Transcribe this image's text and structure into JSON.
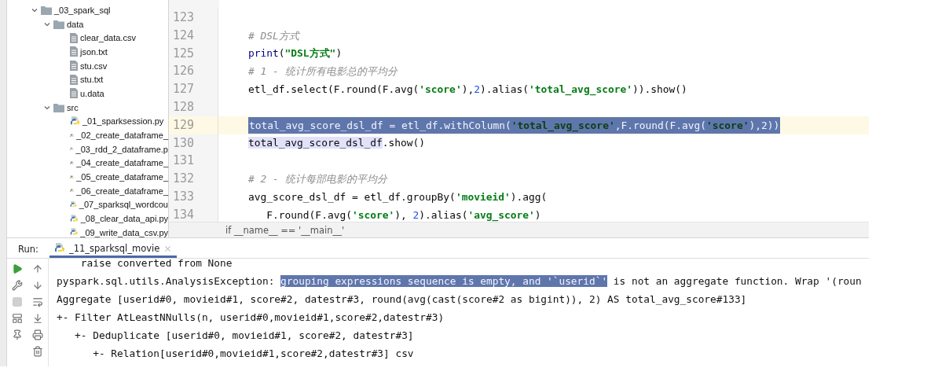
{
  "project_tree": [
    {
      "label": "_03_spark_sql",
      "kind": "folder",
      "expanded": true,
      "children": [
        {
          "label": "data",
          "kind": "folder",
          "expanded": true,
          "children": [
            {
              "label": "clear_data.csv",
              "kind": "file"
            },
            {
              "label": "json.txt",
              "kind": "file"
            },
            {
              "label": "stu.csv",
              "kind": "file"
            },
            {
              "label": "stu.txt",
              "kind": "file"
            },
            {
              "label": "u.data",
              "kind": "file"
            }
          ]
        },
        {
          "label": "src",
          "kind": "folder",
          "expanded": true,
          "children": [
            {
              "label": "_01_sparksession.py",
              "kind": "python"
            },
            {
              "label": "_02_create_dataframe_",
              "kind": "python"
            },
            {
              "label": "_03_rdd_2_dataframe.p",
              "kind": "python"
            },
            {
              "label": "_04_create_dataframe_",
              "kind": "python"
            },
            {
              "label": "_05_create_dataframe_",
              "kind": "python"
            },
            {
              "label": "_06_create_dataframe_",
              "kind": "python"
            },
            {
              "label": "_07_sparksql_wordcou",
              "kind": "python"
            },
            {
              "label": "_08_clear_data_api.py",
              "kind": "python"
            },
            {
              "label": "_09_write_data_csv.py",
              "kind": "python"
            }
          ]
        }
      ]
    }
  ],
  "editor": {
    "lines": [
      {
        "number": "123",
        "current": false,
        "selected": false
      },
      {
        "number": "124",
        "current": false,
        "selected": false,
        "tokens": [
          {
            "text": "# DSL方式",
            "kind": "comment",
            "usage": false
          }
        ]
      },
      {
        "number": "125",
        "current": false,
        "selected": false,
        "tokens": [
          {
            "text": "print",
            "kind": "builtin",
            "usage": false
          },
          {
            "text": "(",
            "kind": "plain",
            "usage": false
          },
          {
            "text": "\"DSL方式\"",
            "kind": "string",
            "usage": false
          },
          {
            "text": ")",
            "kind": "plain",
            "usage": false
          }
        ]
      },
      {
        "number": "126",
        "current": false,
        "selected": false,
        "tokens": [
          {
            "text": "# 1 - 统计所有电影总的平均分",
            "kind": "comment",
            "usage": false
          }
        ]
      },
      {
        "number": "127",
        "current": false,
        "selected": false,
        "tokens": [
          {
            "text": "etl_df.select(F.round(F.avg(",
            "kind": "plain",
            "usage": false
          },
          {
            "text": "'score'",
            "kind": "string",
            "usage": false
          },
          {
            "text": "),",
            "kind": "plain",
            "usage": false
          },
          {
            "text": "2",
            "kind": "number",
            "usage": false
          },
          {
            "text": ").alias(",
            "kind": "plain",
            "usage": false
          },
          {
            "text": "'total_avg_score'",
            "kind": "string",
            "usage": false
          },
          {
            "text": ")).show()",
            "kind": "plain",
            "usage": false
          }
        ]
      },
      {
        "number": "128",
        "current": false,
        "selected": false
      },
      {
        "number": "129",
        "current": true,
        "selected": true,
        "tokens": [
          {
            "text": "total_avg_score_dsl_df = etl_df.withColumn(",
            "kind": "plain",
            "usage": false
          },
          {
            "text": "'total_avg_score'",
            "kind": "string",
            "usage": false
          },
          {
            "text": ",F.round(F.avg(",
            "kind": "plain",
            "usage": false
          },
          {
            "text": "'score'",
            "kind": "string",
            "usage": false
          },
          {
            "text": "),2))",
            "kind": "plain",
            "usage": false
          }
        ]
      },
      {
        "number": "130",
        "current": false,
        "selected": false,
        "tokens": [
          {
            "text": "total_avg_score_dsl_df",
            "kind": "plain",
            "usage": true
          },
          {
            "text": ".show()",
            "kind": "plain",
            "usage": false
          }
        ]
      },
      {
        "number": "131",
        "current": false,
        "selected": false
      },
      {
        "number": "132",
        "current": false,
        "selected": false,
        "tokens": [
          {
            "text": "# 2 - 统计每部电影的平均分",
            "kind": "comment",
            "usage": false
          }
        ]
      },
      {
        "number": "133",
        "current": false,
        "selected": false,
        "tokens": [
          {
            "text": "avg_score_dsl_df = etl_df.groupBy(",
            "kind": "plain",
            "usage": false
          },
          {
            "text": "'movieid'",
            "kind": "string",
            "usage": false
          },
          {
            "text": ").agg(",
            "kind": "plain",
            "usage": false
          }
        ]
      },
      {
        "number": "134",
        "current": false,
        "selected": false,
        "tokens": [
          {
            "text": "   F.round(F.avg(",
            "kind": "plain",
            "usage": false
          },
          {
            "text": "'score'",
            "kind": "string",
            "usage": false
          },
          {
            "text": "), ",
            "kind": "plain",
            "usage": false
          },
          {
            "text": "2",
            "kind": "number",
            "usage": false
          },
          {
            "text": ").alias(",
            "kind": "plain",
            "usage": false
          },
          {
            "text": "'avg_score'",
            "kind": "string",
            "usage": false
          },
          {
            "text": ")",
            "kind": "plain",
            "usage": false
          }
        ]
      }
    ],
    "breadcrumb": "if __name__ == '__main__'"
  },
  "run_panel": {
    "label": "Run:",
    "tabs": [
      {
        "label": "_11_sparksql_movie",
        "selected": true
      }
    ],
    "console": [
      [
        {
          "text": "    raise converted from None",
          "selected": false
        }
      ],
      [
        {
          "text": "pyspark.sql.utils.AnalysisException: ",
          "selected": false
        },
        {
          "text": "grouping expressions sequence is empty, and '`userid`'",
          "selected": true
        },
        {
          "text": " is not an aggregate function. Wrap '(roun",
          "selected": false
        }
      ],
      [
        {
          "text": "Aggregate [userid#0, movieid#1, score#2, datestr#3, round(avg(cast(score#2 as bigint)), 2) AS total_avg_score#133]",
          "selected": false
        }
      ],
      [
        {
          "text": "+- Filter AtLeastNNulls(n, userid#0,movieid#1,score#2,datestr#3)",
          "selected": false
        }
      ],
      [
        {
          "text": "   +- Deduplicate [userid#0, movieid#1, score#2, datestr#3]",
          "selected": false
        }
      ],
      [
        {
          "text": "      +- Relation[userid#0,movieid#1,score#2,datestr#3] csv",
          "selected": false
        }
      ]
    ]
  }
}
